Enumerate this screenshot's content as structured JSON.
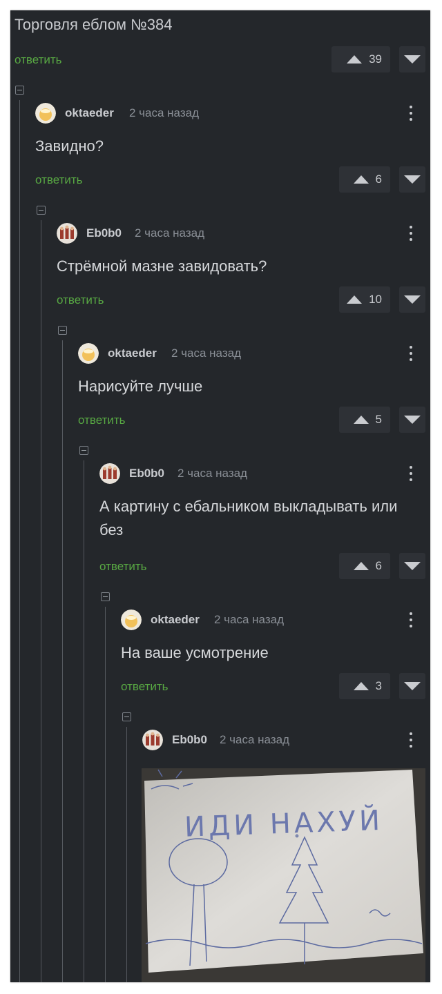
{
  "post": {
    "title": "Торговля еблом №384",
    "reply_label": "ответить",
    "score": "39"
  },
  "comments": [
    {
      "author": "oktaeder",
      "time": "2 часа назад",
      "text": "Завидно?",
      "reply_label": "ответить",
      "score": "6"
    },
    {
      "author": "Eb0b0",
      "time": "2 часа назад",
      "text": "Стрёмной мазне завидовать?",
      "reply_label": "ответить",
      "score": "10"
    },
    {
      "author": "oktaeder",
      "time": "2 часа назад",
      "text": "Нарисуйте лучше",
      "reply_label": "ответить",
      "score": "5"
    },
    {
      "author": "Eb0b0",
      "time": "2 часа назад",
      "text": "А картину с ебальником выкладывать или без",
      "reply_label": "ответить",
      "score": "6"
    },
    {
      "author": "oktaeder",
      "time": "2 часа назад",
      "text": "На ваше усмотрение",
      "reply_label": "ответить",
      "score": "3"
    },
    {
      "author": "Eb0b0",
      "time": "2 часа назад"
    }
  ],
  "drawing": {
    "text": "ИДИ НАХУЙ"
  },
  "colors": {
    "background": "#24272b",
    "reply": "#58a843",
    "vote_box": "#2e3136",
    "text": "#d6d8db"
  },
  "icons": [
    "collapse-icon",
    "upvote-icon",
    "downvote-icon",
    "more-vertical-icon"
  ]
}
